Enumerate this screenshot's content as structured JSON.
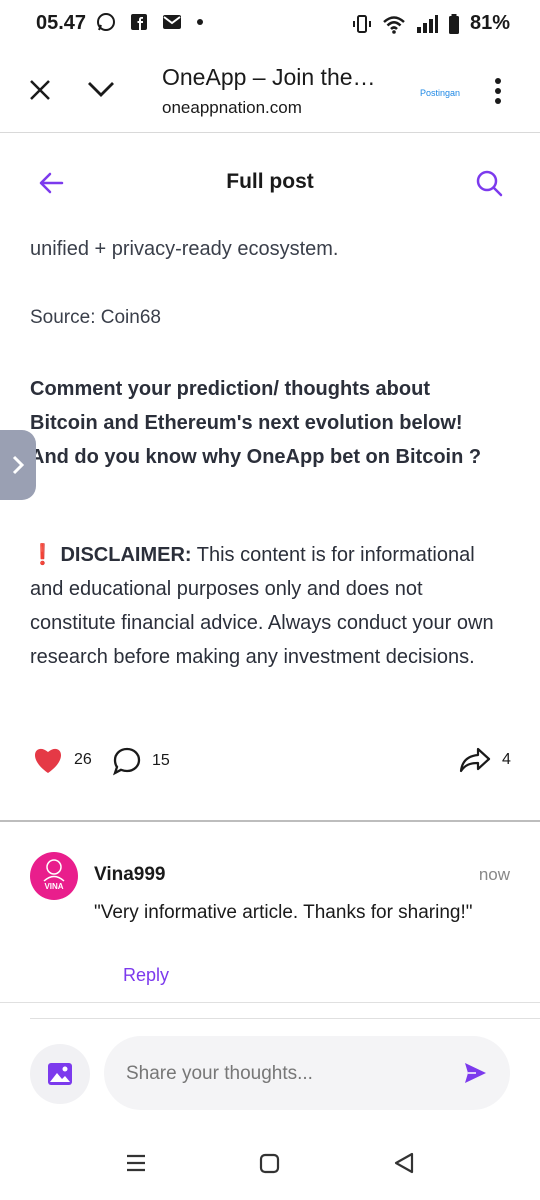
{
  "status_bar": {
    "time": "05.47",
    "battery": "81%"
  },
  "browser": {
    "title": "OneApp – Join the…",
    "url": "oneappnation.com",
    "tag": "Postingan"
  },
  "header": {
    "title": "Full post"
  },
  "post": {
    "text1": "unified + privacy-ready ecosystem.",
    "source": "Source: Coin68",
    "question": "Comment your prediction/ thoughts about Bitcoin and Ethereum's next evolution below! And do you know why OneApp bet on Bitcoin ?",
    "disclaimer_icon": "❗",
    "disclaimer_label": "DISCLAIMER:",
    "disclaimer_text": " This content is for informational and educational purposes only and does not constitute financial advice. Always conduct your own research before making any investment decisions."
  },
  "reactions": {
    "likes": "26",
    "comments": "15",
    "shares": "4"
  },
  "comment": {
    "avatar_text": "VINA",
    "user": "Vina999",
    "time": "now",
    "text": "\"Very informative article. Thanks for sharing!\"",
    "reply_label": "Reply"
  },
  "composer": {
    "placeholder": "Share your thoughts..."
  },
  "colors": {
    "accent": "#7c3aed",
    "like": "#e53946",
    "avatar": "#e91e8c"
  }
}
